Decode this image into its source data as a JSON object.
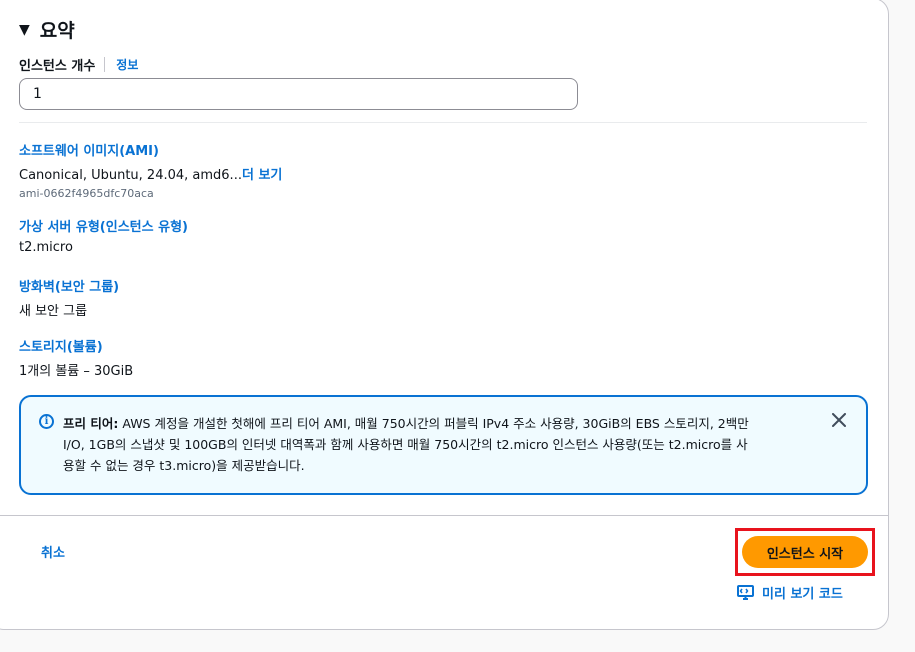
{
  "summary": {
    "title": "요약",
    "instance_count": {
      "label": "인스턴스 개수",
      "info_link": "정보",
      "value": "1"
    },
    "ami": {
      "title": "소프트웨어 이미지(AMI)",
      "value": "Canonical, Ubuntu, 24.04, amd6...",
      "more_link": "더 보기",
      "id": "ami-0662f4965dfc70aca"
    },
    "instance_type": {
      "title": "가상 서버 유형(인스턴스 유형)",
      "value": "t2.micro"
    },
    "firewall": {
      "title": "방화벽(보안 그룹)",
      "value": "새 보안 그룹"
    },
    "storage": {
      "title": "스토리지(볼륨)",
      "value": "1개의 볼륨 – 30GiB"
    },
    "free_tier_alert": {
      "label": "프리 티어:",
      "line1": " AWS 계정을 개설한 첫해에 프리 티어 AMI, 매월 750시간의 퍼블릭 IPv4 주소 사용량, 30GiB의 EBS 스토리지, 2백만",
      "line2": "I/O, 1GB의 스냅샷 및 100GB의 인터넷 대역폭과 함께 사용하면 매월 750시간의 t2.micro 인스턴스 사용량(또는 t2.micro를 사",
      "line3": "용할 수 없는 경우 t3.micro)을 제공받습니다."
    }
  },
  "footer": {
    "cancel_label": "취소",
    "launch_label": "인스턴스 시작",
    "preview_code_label": "미리 보기 코드"
  },
  "icons": {
    "caret": "caret-down-icon",
    "info": "info-circle-icon",
    "close": "close-icon",
    "code": "code-preview-icon"
  },
  "colors": {
    "link": "#0972d3",
    "primary_button": "#ff9900",
    "highlight": "#e8131d",
    "alert_bg": "#f0fbff"
  }
}
